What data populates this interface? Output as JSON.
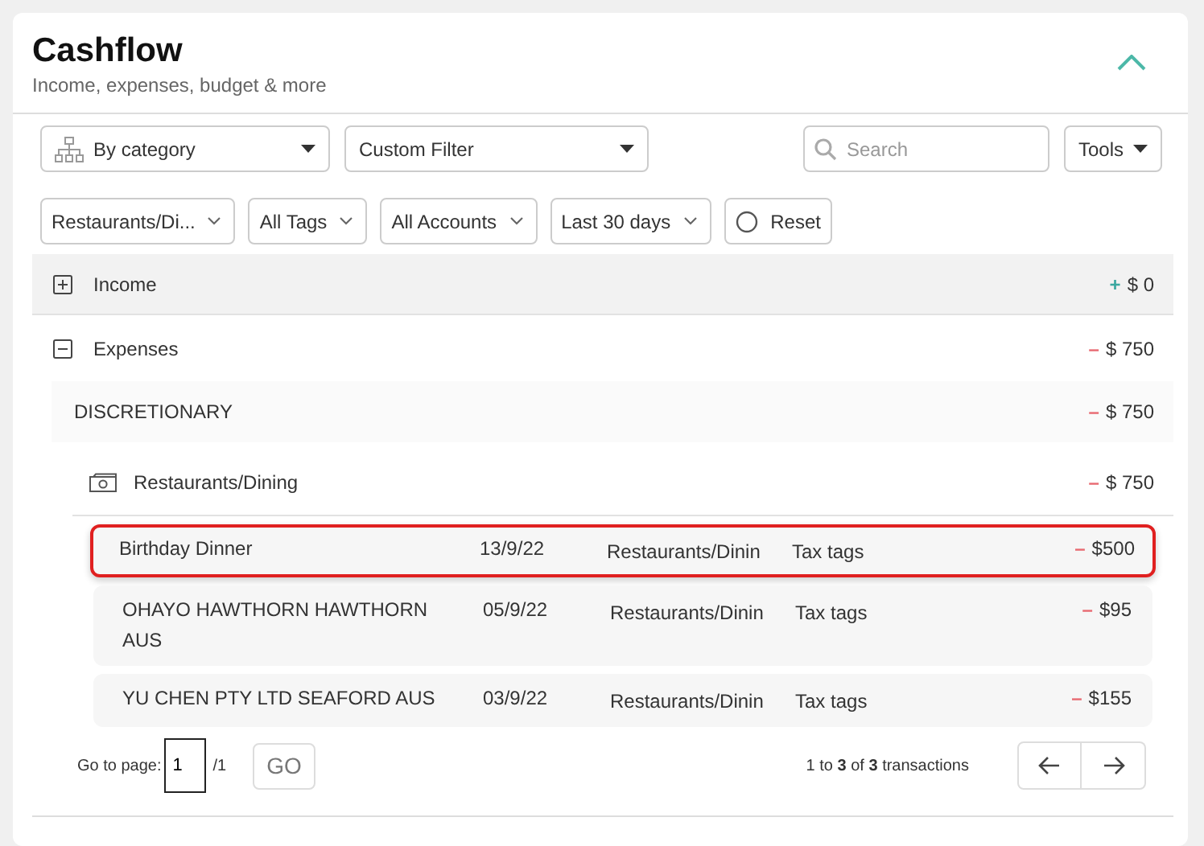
{
  "header": {
    "title": "Cashflow",
    "subtitle": "Income, expenses, budget & more"
  },
  "toolbar": {
    "group_by": "By category",
    "filter": "Custom Filter",
    "search": {
      "placeholder": "Search"
    },
    "tools": "Tools"
  },
  "filters": [
    {
      "label": "Restaurants/Di..."
    },
    {
      "label": "All Tags"
    },
    {
      "label": "All Accounts"
    },
    {
      "label": "Last 30 days"
    }
  ],
  "reset": "Reset",
  "groups": [
    {
      "label": "Income",
      "expanded": false,
      "color": "#3aa8a0",
      "sign": "+",
      "amount": "$ 0"
    },
    {
      "label": "Expenses",
      "expanded": true,
      "color": "#e86a72",
      "sign": "–",
      "amount": "$ 750"
    }
  ],
  "category_group": {
    "label": "DISCRETIONARY",
    "color": "#e86a72",
    "sign": "–",
    "amount": "$ 750"
  },
  "category": {
    "label": "Restaurants/Dining",
    "color": "#e86a72",
    "sign": "–",
    "amount": "$ 750"
  },
  "transactions": [
    {
      "description": "Birthday Dinner",
      "date": "13/9/22",
      "category": "Restaurants/Dinin",
      "tags": "Tax tags",
      "color": "#e86a72",
      "sign": "–",
      "amount": "$500",
      "selected": true
    },
    {
      "description": "OHAYO  HAWTHORN  HAWTHORN AUS",
      "date": "05/9/22",
      "category": "Restaurants/Dinin",
      "tags": "Tax tags",
      "color": "#e86a72",
      "sign": "–",
      "amount": "$95",
      "selected": false
    },
    {
      "description": "YU CHEN PTY LTD SEAFORD AUS",
      "date": "03/9/22",
      "category": "Restaurants/Dinin",
      "tags": "Tax tags",
      "color": "#e86a72",
      "sign": "–",
      "amount": "$155",
      "selected": false
    }
  ],
  "pagination": {
    "label": "Go to page:",
    "page": "1",
    "total": "/1",
    "go": "GO",
    "summary": "1 to **3** of **3** transactions"
  }
}
